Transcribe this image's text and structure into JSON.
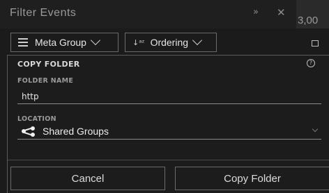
{
  "window": {
    "title": "Filter Events",
    "clipped_value": "3,00"
  },
  "toolbar": {
    "meta_group_label": "Meta Group",
    "ordering_label": "Ordering",
    "sort_glyph": "↓a z"
  },
  "panel": {
    "title": "COPY FOLDER",
    "help_glyph": "?",
    "folder_name_label": "FOLDER NAME",
    "folder_name_value": "http",
    "location_label": "LOCATION",
    "location_value": "Shared Groups"
  },
  "buttons": {
    "cancel": "Cancel",
    "copy": "Copy Folder"
  },
  "icons": [
    "expand-icon",
    "close-icon",
    "menu-icon",
    "sort-icon",
    "chevron-down-icon",
    "maximize-icon",
    "help-icon",
    "share-icon"
  ],
  "colors": {
    "background": "#1b1b1b",
    "border": "#6a6a6a",
    "text": "#e6e6e6",
    "muted": "#9a9a9a"
  }
}
